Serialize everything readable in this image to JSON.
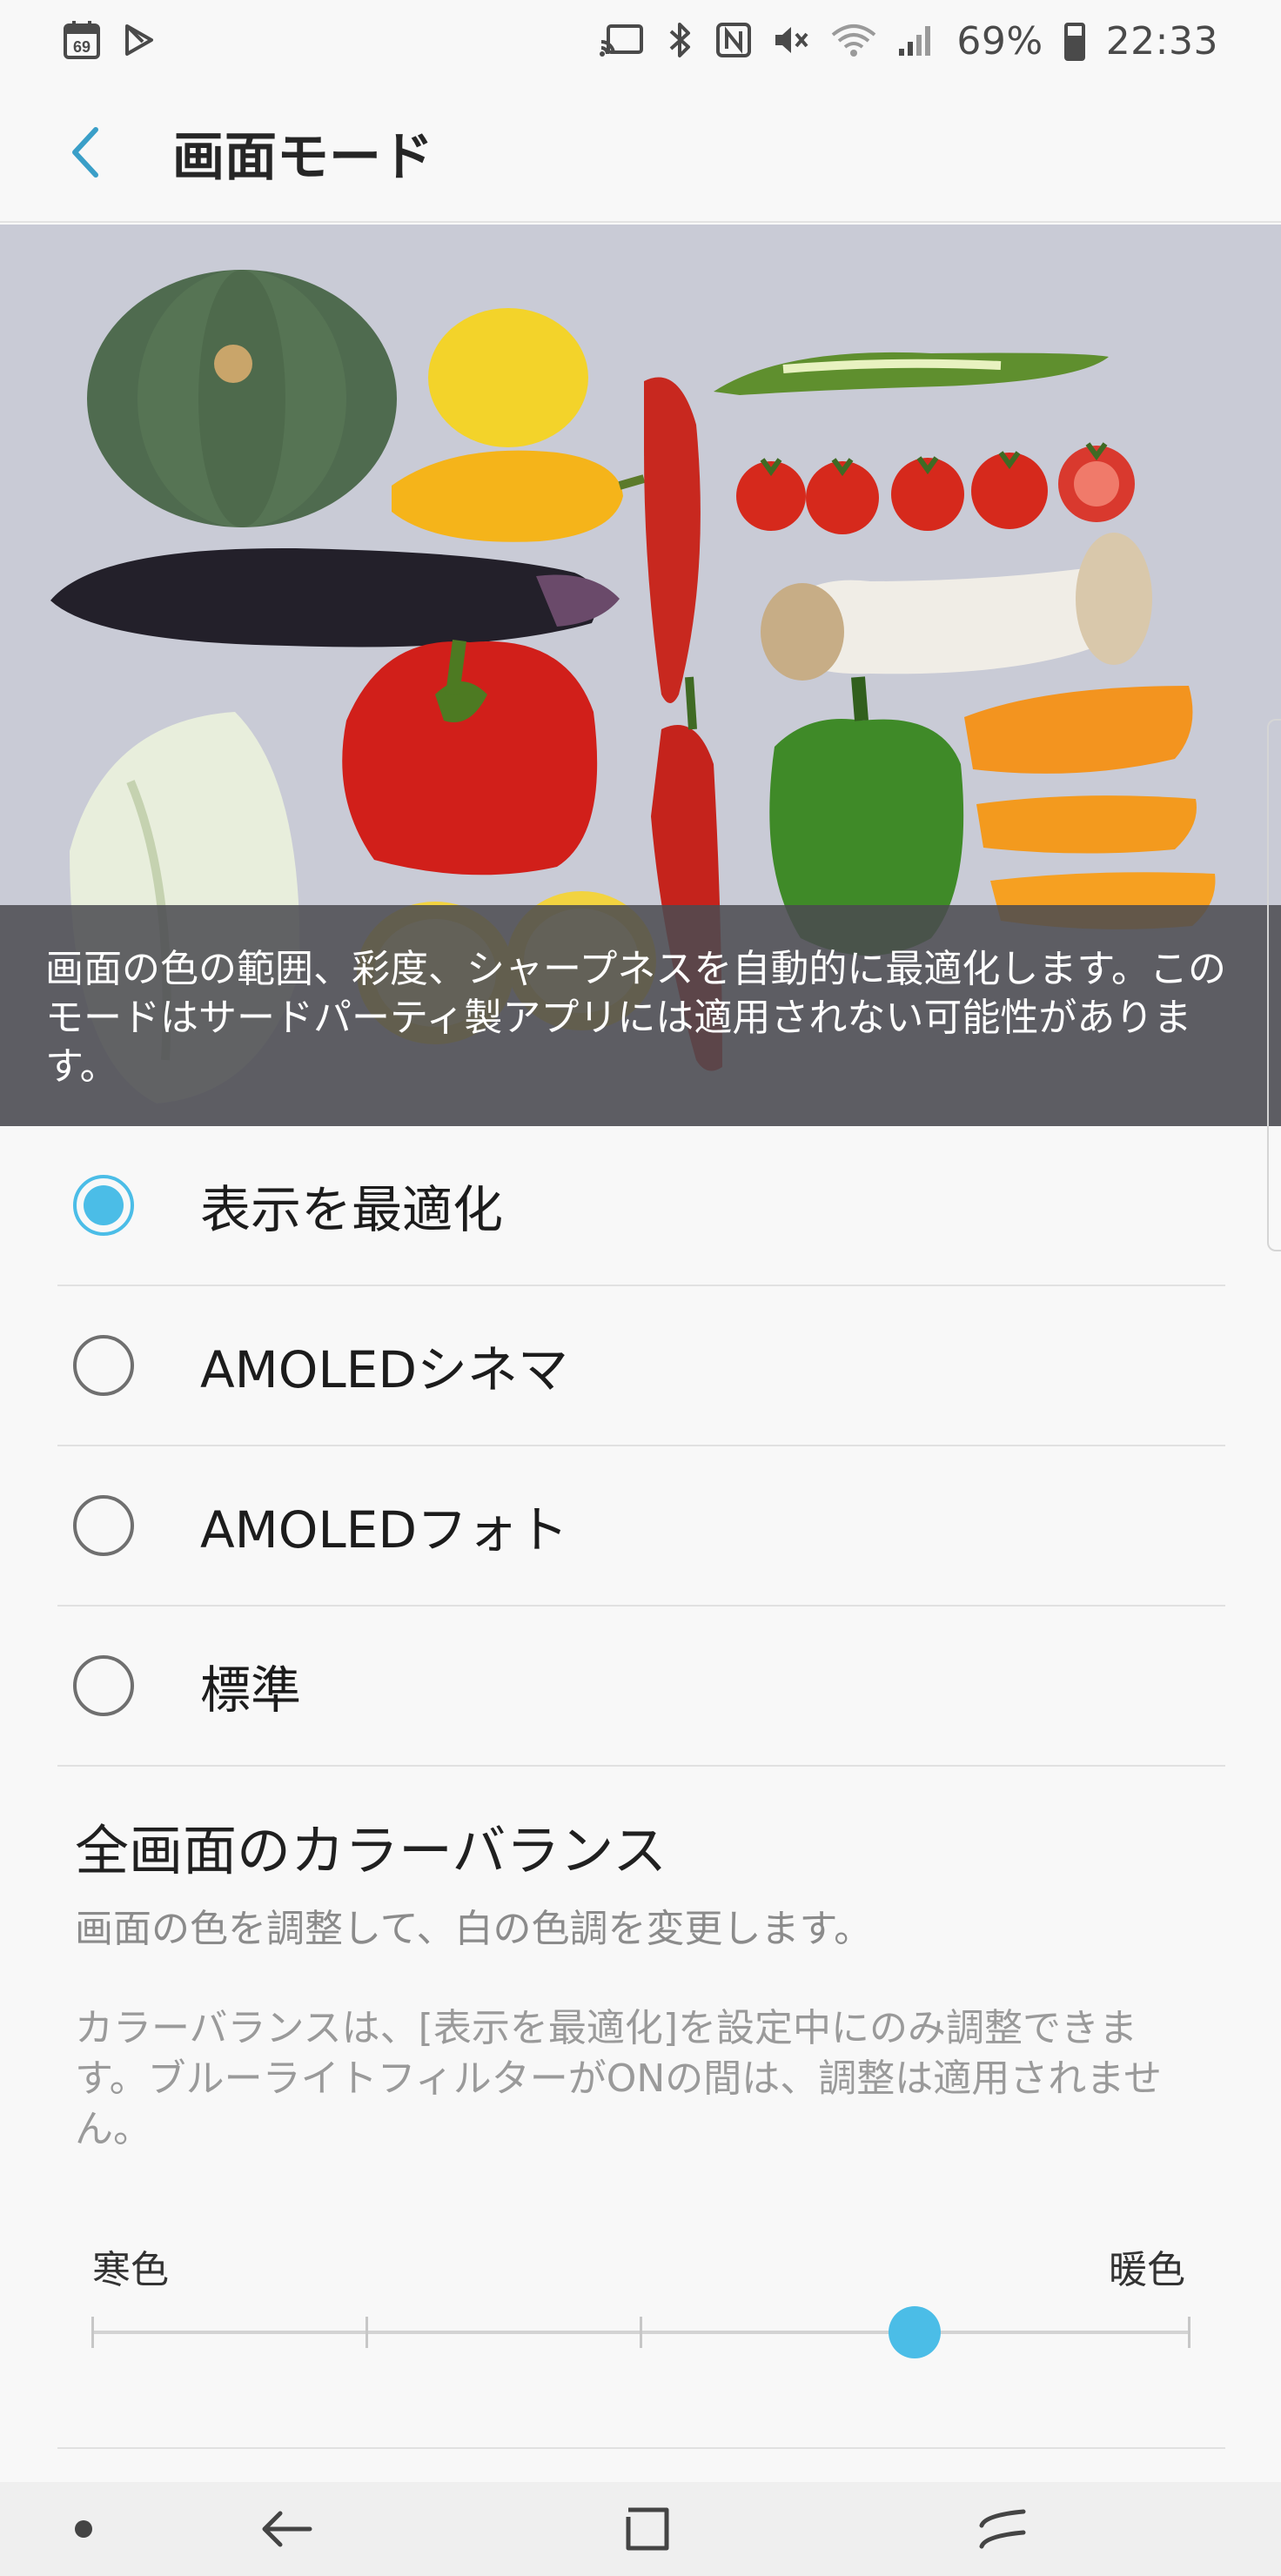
{
  "status_bar": {
    "left_icons": [
      "calendar-69-icon",
      "play-store-icon"
    ],
    "calendar_day": "69",
    "right_icons": [
      "cast-icon",
      "bluetooth-icon",
      "nfc-icon",
      "mute-icon",
      "wifi-icon",
      "signal-icon",
      "battery-icon"
    ],
    "battery_percent": "69%",
    "battery_level": 0.69,
    "time": "22:33"
  },
  "header": {
    "back_icon": "chevron-left-icon",
    "title": "画面モード",
    "accent": "#4bbde7"
  },
  "hero": {
    "caption": "画面の色の範囲、彩度、シャープネスを自動的に最適化します。このモードはサードパーティ製アプリには適用されない可能性があります。"
  },
  "modes": [
    {
      "label": "表示を最適化",
      "selected": true
    },
    {
      "label": "AMOLEDシネマ",
      "selected": false
    },
    {
      "label": "AMOLEDフォト",
      "selected": false
    },
    {
      "label": "標準",
      "selected": false
    }
  ],
  "color_balance": {
    "title": "全画面のカラーバランス",
    "subtitle": "画面の色を調整して、白の色調を変更します。",
    "note": "カラーバランスは、[表示を最適化]を設定中にのみ調整できます。ブルーライトフィルターがONの間は、調整は適用されません。",
    "label_cool": "寒色",
    "label_warm": "暖色",
    "steps": 5,
    "value_index": 3
  },
  "nav_bar": {
    "items": [
      "dot-icon",
      "back-arrow-icon",
      "home-square-icon",
      "recents-icon"
    ]
  }
}
